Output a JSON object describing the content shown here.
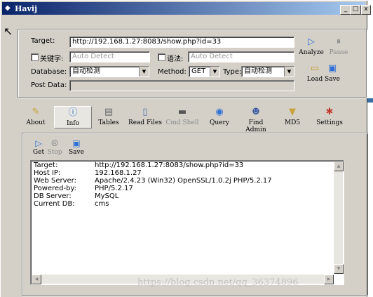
{
  "window": {
    "title": "Havij",
    "icon": "havij-icon",
    "controls": [
      "minimize",
      "maximize",
      "close"
    ]
  },
  "target_label": "Target:",
  "target_value": "http://192.168.1.27:8083/show.php?id=33",
  "keyword": {
    "label": "关键字:",
    "placeholder": "Auto Detect"
  },
  "syntax": {
    "label": "语法:",
    "placeholder": "Auto Detect"
  },
  "database": {
    "label": "Database:",
    "value": "自动检测"
  },
  "method": {
    "label": "Method:",
    "value": "GET"
  },
  "type": {
    "label": "Type:",
    "value": "自动检测"
  },
  "postdata": {
    "label": "Post Data:",
    "value": ""
  },
  "actions": {
    "analyze": "Analyze",
    "pause": "Pause",
    "load": "Load",
    "save": "Save"
  },
  "nav": [
    {
      "label": "About",
      "icon": "about-icon"
    },
    {
      "label": "Info",
      "icon": "info-icon"
    },
    {
      "label": "Tables",
      "icon": "tables-icon"
    },
    {
      "label": "Read Files",
      "icon": "read-files-icon"
    },
    {
      "label": "Cmd Shell",
      "icon": "cmd-shell-icon"
    },
    {
      "label": "Query",
      "icon": "query-icon"
    },
    {
      "label": "Find Admin",
      "icon": "find-admin-icon"
    },
    {
      "label": "MD5",
      "icon": "md5-icon"
    },
    {
      "label": "Settings",
      "icon": "settings-icon"
    }
  ],
  "info_toolbar": {
    "get": "Get",
    "stop": "Stop",
    "save": "Save"
  },
  "info": [
    {
      "key": "Target:",
      "value": "http://192.168.1.27:8083/show.php?id=33"
    },
    {
      "key": "Host IP:",
      "value": "192.168.1.27"
    },
    {
      "key": "Web Server:",
      "value": "Apache/2.4.23 (Win32) OpenSSL/1.0.2j PHP/5.2.17"
    },
    {
      "key": "Powered-by:",
      "value": "PHP/5.2.17"
    },
    {
      "key": "DB Server:",
      "value": "MySQL"
    },
    {
      "key": "Current DB:",
      "value": "cms"
    }
  ],
  "watermark": "https://blog.csdn.net/qq_36374896"
}
